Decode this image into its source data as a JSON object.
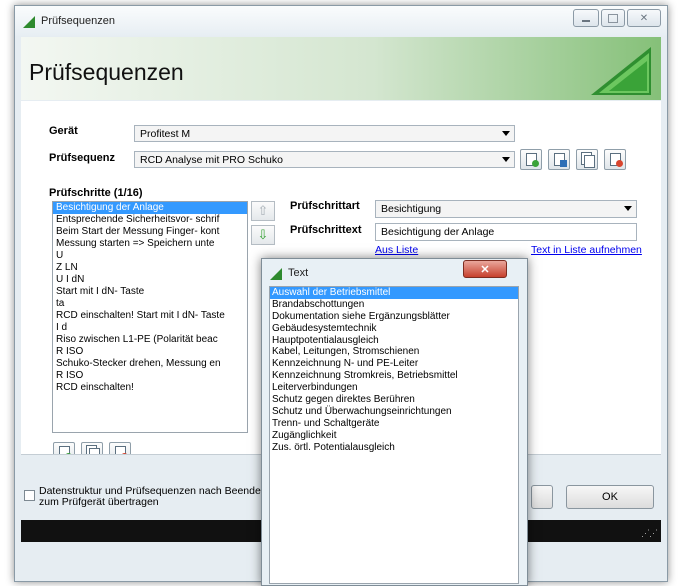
{
  "window": {
    "title": "Prüfsequenzen",
    "header_title": "Prüfsequenzen"
  },
  "device": {
    "label": "Gerät",
    "value": "Profitest M"
  },
  "sequence": {
    "label": "Prüfsequenz",
    "value": "RCD Analyse mit PRO Schuko"
  },
  "steps": {
    "heading": "Prüfschritte (1/16)",
    "items": [
      "Besichtigung der  Anlage",
      "Entsprechende     Sicherheitsvor-   schrif",
      "Beim Start der     Messung Finger-  kont",
      "Messung starten   => Speichern      unte",
      "U",
      "Z LN",
      "U I dN",
      "Start mit I dN-   Taste",
      "ta",
      "RCD einschalten!  Start mit I dN-   Taste",
      "I d",
      "Riso zwischen     L1-PE (Polarität  beac",
      "R ISO",
      "Schuko-Stecker   drehen, Messung  en",
      "R ISO",
      "RCD einschalten!"
    ]
  },
  "step_type": {
    "label": "Prüfschrittart",
    "value": "Besichtigung"
  },
  "step_text": {
    "label": "Prüfschrittext",
    "value": "Besichtigung der  Anlage"
  },
  "links": {
    "from_list": "Aus Liste",
    "add_to_list": "Text in Liste aufnehmen"
  },
  "footer": {
    "checkbox_label": "Datenstruktur und Prüfsequenzen nach Beenden zum Prüfgerät übertragen",
    "ok": "OK"
  },
  "popup": {
    "title": "Text",
    "items": [
      "Auswahl der Betriebsmittel",
      "Brandabschottungen",
      "Dokumentation siehe Ergänzungsblätter",
      "Gebäudesystemtechnik",
      "Hauptpotentialausgleich",
      "Kabel, Leitungen, Stromschienen",
      "Kennzeichnung N- und PE-Leiter",
      "Kennzeichnung Stromkreis, Betriebsmittel",
      "Leiterverbindungen",
      "Schutz gegen direktes Berühren",
      "Schutz und Überwachungseinrichtungen",
      "Trenn- und Schaltgeräte",
      "Zugänglichkeit",
      "Zus. örtl. Potentialausgleich"
    ]
  },
  "colors": {
    "accent_green": "#2e8a2e",
    "selection": "#3399ff",
    "link": "#0000ee",
    "close_red": "#c7402c"
  }
}
